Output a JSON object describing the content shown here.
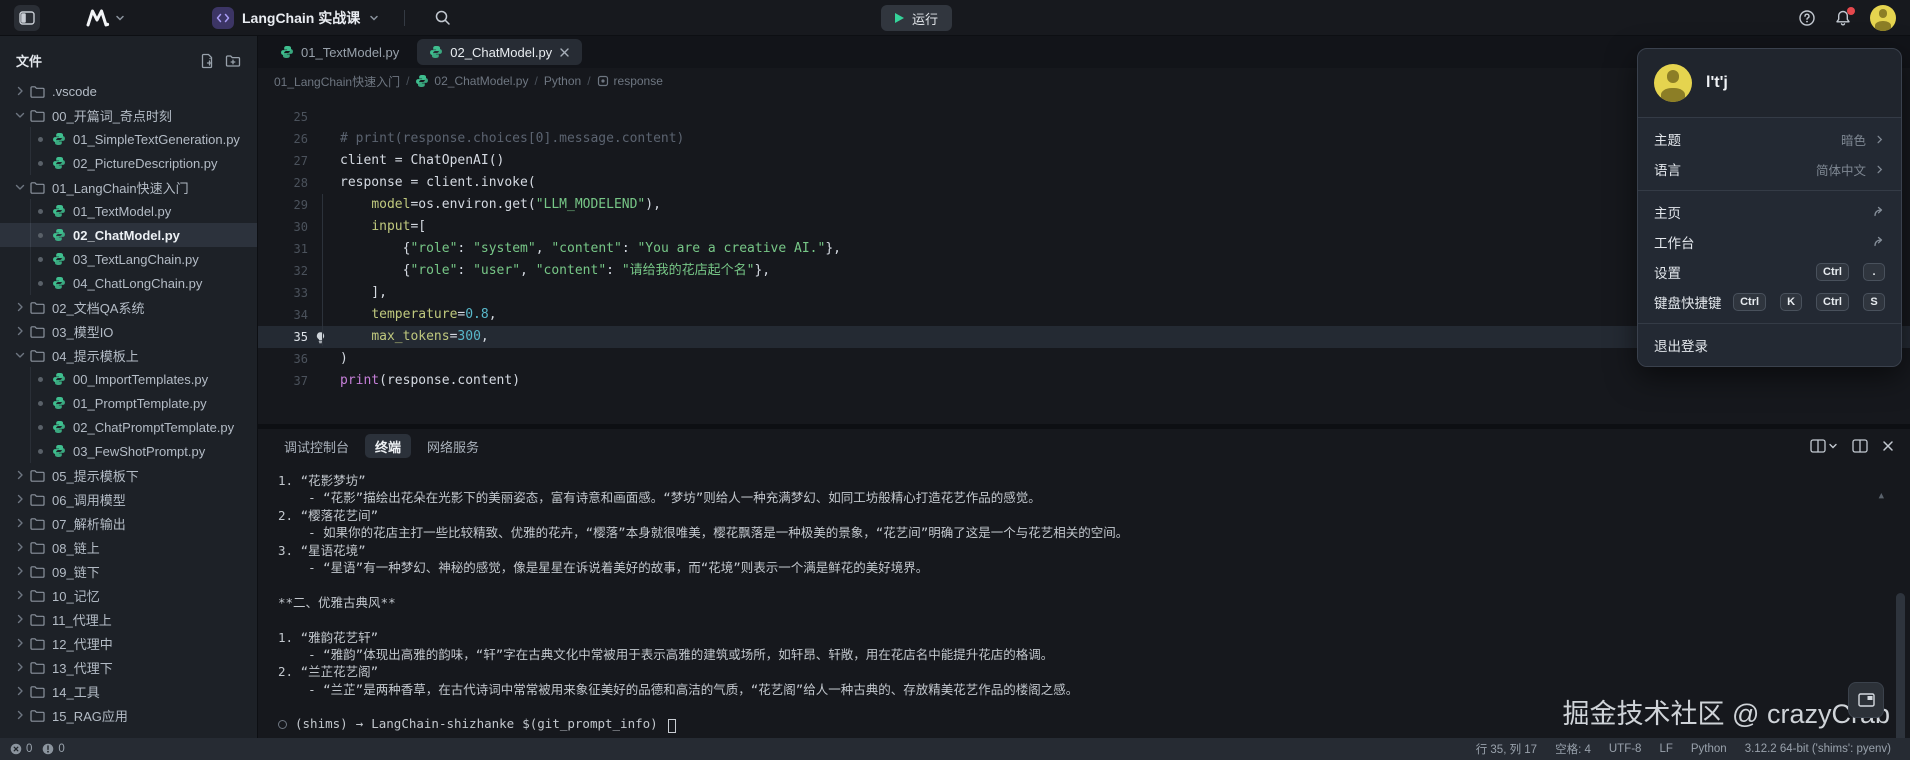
{
  "topbar": {
    "project_name": "LangChain 实战课",
    "run_label": "运行"
  },
  "sidebar": {
    "title": "文件",
    "tree": [
      {
        "type": "folder",
        "expanded": false,
        "label": ".vscode"
      },
      {
        "type": "folder",
        "expanded": true,
        "label": "00_开篇词_奇点时刻"
      },
      {
        "type": "file",
        "label": "01_SimpleTextGeneration.py"
      },
      {
        "type": "file",
        "label": "02_PictureDescription.py"
      },
      {
        "type": "folder",
        "expanded": true,
        "label": "01_LangChain快速入门"
      },
      {
        "type": "file",
        "label": "01_TextModel.py"
      },
      {
        "type": "file",
        "label": "02_ChatModel.py",
        "selected": true
      },
      {
        "type": "file",
        "label": "03_TextLangChain.py"
      },
      {
        "type": "file",
        "label": "04_ChatLongChain.py"
      },
      {
        "type": "folder",
        "expanded": false,
        "label": "02_文档QA系统"
      },
      {
        "type": "folder",
        "expanded": false,
        "label": "03_模型IO"
      },
      {
        "type": "folder",
        "expanded": true,
        "label": "04_提示模板上"
      },
      {
        "type": "file",
        "label": "00_ImportTemplates.py"
      },
      {
        "type": "file",
        "label": "01_PromptTemplate.py"
      },
      {
        "type": "file",
        "label": "02_ChatPromptTemplate.py"
      },
      {
        "type": "file",
        "label": "03_FewShotPrompt.py"
      },
      {
        "type": "folder",
        "expanded": false,
        "label": "05_提示模板下"
      },
      {
        "type": "folder",
        "expanded": false,
        "label": "06_调用模型"
      },
      {
        "type": "folder",
        "expanded": false,
        "label": "07_解析输出"
      },
      {
        "type": "folder",
        "expanded": false,
        "label": "08_链上"
      },
      {
        "type": "folder",
        "expanded": false,
        "label": "09_链下"
      },
      {
        "type": "folder",
        "expanded": false,
        "label": "10_记忆"
      },
      {
        "type": "folder",
        "expanded": false,
        "label": "11_代理上"
      },
      {
        "type": "folder",
        "expanded": false,
        "label": "12_代理中"
      },
      {
        "type": "folder",
        "expanded": false,
        "label": "13_代理下"
      },
      {
        "type": "folder",
        "expanded": false,
        "label": "14_工具"
      },
      {
        "type": "folder",
        "expanded": false,
        "label": "15_RAG应用"
      }
    ]
  },
  "editor": {
    "tabs": [
      {
        "label": "01_TextModel.py",
        "active": false,
        "closable": false
      },
      {
        "label": "02_ChatModel.py",
        "active": true,
        "closable": true
      }
    ],
    "breadcrumb": [
      {
        "label": "01_LangChain快速入门"
      },
      {
        "label": "02_ChatModel.py",
        "icon": "python"
      },
      {
        "label": "Python"
      },
      {
        "label": "response",
        "icon": "symbol"
      }
    ],
    "current_line": 35,
    "lines": [
      {
        "n": 25,
        "tk": []
      },
      {
        "n": 26,
        "tk": [
          {
            "c": "c",
            "t": "# print(response.choices[0].message.content)"
          }
        ]
      },
      {
        "n": 27,
        "tk": [
          {
            "c": "p",
            "t": "client = ChatOpenAI()"
          }
        ]
      },
      {
        "n": 28,
        "tk": [
          {
            "c": "p",
            "t": "response = client.invoke("
          }
        ]
      },
      {
        "n": 29,
        "tk": [
          {
            "c": "p",
            "t": "    "
          },
          {
            "c": "a",
            "t": "model"
          },
          {
            "c": "p",
            "t": "=os.environ.get("
          },
          {
            "c": "s",
            "t": "\"LLM_MODELEND\""
          },
          {
            "c": "p",
            "t": "),"
          }
        ]
      },
      {
        "n": 30,
        "tk": [
          {
            "c": "p",
            "t": "    "
          },
          {
            "c": "a",
            "t": "input"
          },
          {
            "c": "p",
            "t": "=["
          }
        ]
      },
      {
        "n": 31,
        "tk": [
          {
            "c": "p",
            "t": "        {"
          },
          {
            "c": "s",
            "t": "\"role\""
          },
          {
            "c": "p",
            "t": ": "
          },
          {
            "c": "s",
            "t": "\"system\""
          },
          {
            "c": "p",
            "t": ", "
          },
          {
            "c": "s",
            "t": "\"content\""
          },
          {
            "c": "p",
            "t": ": "
          },
          {
            "c": "s",
            "t": "\"You are a creative AI.\""
          },
          {
            "c": "p",
            "t": "},"
          }
        ]
      },
      {
        "n": 32,
        "tk": [
          {
            "c": "p",
            "t": "        {"
          },
          {
            "c": "s",
            "t": "\"role\""
          },
          {
            "c": "p",
            "t": ": "
          },
          {
            "c": "s",
            "t": "\"user\""
          },
          {
            "c": "p",
            "t": ", "
          },
          {
            "c": "s",
            "t": "\"content\""
          },
          {
            "c": "p",
            "t": ": "
          },
          {
            "c": "s",
            "t": "\"请给我的花店起个名\""
          },
          {
            "c": "p",
            "t": "},"
          }
        ]
      },
      {
        "n": 33,
        "tk": [
          {
            "c": "p",
            "t": "    ],"
          }
        ]
      },
      {
        "n": 34,
        "tk": [
          {
            "c": "p",
            "t": "    "
          },
          {
            "c": "a",
            "t": "temperature"
          },
          {
            "c": "p",
            "t": "="
          },
          {
            "c": "n",
            "t": "0.8"
          },
          {
            "c": "p",
            "t": ","
          }
        ]
      },
      {
        "n": 35,
        "tk": [
          {
            "c": "p",
            "t": "    "
          },
          {
            "c": "a",
            "t": "max_tokens"
          },
          {
            "c": "p",
            "t": "="
          },
          {
            "c": "n",
            "t": "300"
          },
          {
            "c": "p",
            "t": ","
          }
        ]
      },
      {
        "n": 36,
        "tk": [
          {
            "c": "p",
            "t": ")"
          }
        ]
      },
      {
        "n": 37,
        "tk": [
          {
            "c": "k",
            "t": "print"
          },
          {
            "c": "p",
            "t": "(response.content)"
          }
        ]
      }
    ]
  },
  "panel": {
    "tabs": [
      {
        "label": "调试控制台",
        "active": false
      },
      {
        "label": "终端",
        "active": true
      },
      {
        "label": "网络服务",
        "active": false
      }
    ],
    "terminal": {
      "lines": [
        "1. “花影梦坊”",
        "    - “花影”描绘出花朵在光影下的美丽姿态，富有诗意和画面感。“梦坊”则给人一种充满梦幻、如同工坊般精心打造花艺作品的感觉。",
        "2. “樱落花艺间”",
        "    - 如果你的花店主打一些比较精致、优雅的花卉，“樱落”本身就很唯美，樱花飘落是一种极美的景象，“花艺间”明确了这是一个与花艺相关的空间。",
        "3. “星语花境”",
        "    - “星语”有一种梦幻、神秘的感觉，像是星星在诉说着美好的故事，而“花境”则表示一个满是鲜花的美好境界。",
        "",
        "**二、优雅古典风**",
        "",
        "1. “雅韵花艺轩”",
        "    - “雅韵”体现出高雅的韵味，“轩”字在古典文化中常被用于表示高雅的建筑或场所，如轩昂、轩敞，用在花店名中能提升花店的格调。",
        "2. “兰芷花艺阁”",
        "    - “兰芷”是两种香草，在古代诗词中常常被用来象征美好的品德和高洁的气质，“花艺阁”给人一种古典的、存放精美花艺作品的楼阁之感。",
        ""
      ],
      "prompt": {
        "venv": "(shims)",
        "arrow": "→",
        "dir": "LangChain-shizhanke",
        "suffix": "$(git_prompt_info)"
      }
    }
  },
  "user_menu": {
    "username": "l't'j",
    "groups": [
      [
        {
          "label": "主题",
          "value": "暗色",
          "trail": "chevron"
        },
        {
          "label": "语言",
          "value": "简体中文",
          "trail": "chevron"
        }
      ],
      [
        {
          "label": "主页",
          "trail": "external"
        },
        {
          "label": "工作台",
          "trail": "external"
        },
        {
          "label": "设置",
          "keys": [
            "Ctrl",
            "."
          ]
        },
        {
          "label": "键盘快捷键",
          "keys": [
            "Ctrl",
            "K",
            "Ctrl",
            "S"
          ]
        }
      ],
      [
        {
          "label": "退出登录"
        }
      ]
    ]
  },
  "statusbar": {
    "errors": "0",
    "warnings": "0",
    "items": [
      "行 35, 列 17",
      "空格: 4",
      "UTF-8",
      "LF",
      "Python",
      "3.12.2 64-bit ('shims': pyenv)"
    ]
  },
  "watermark": "掘金技术社区 @ crazyCrab"
}
